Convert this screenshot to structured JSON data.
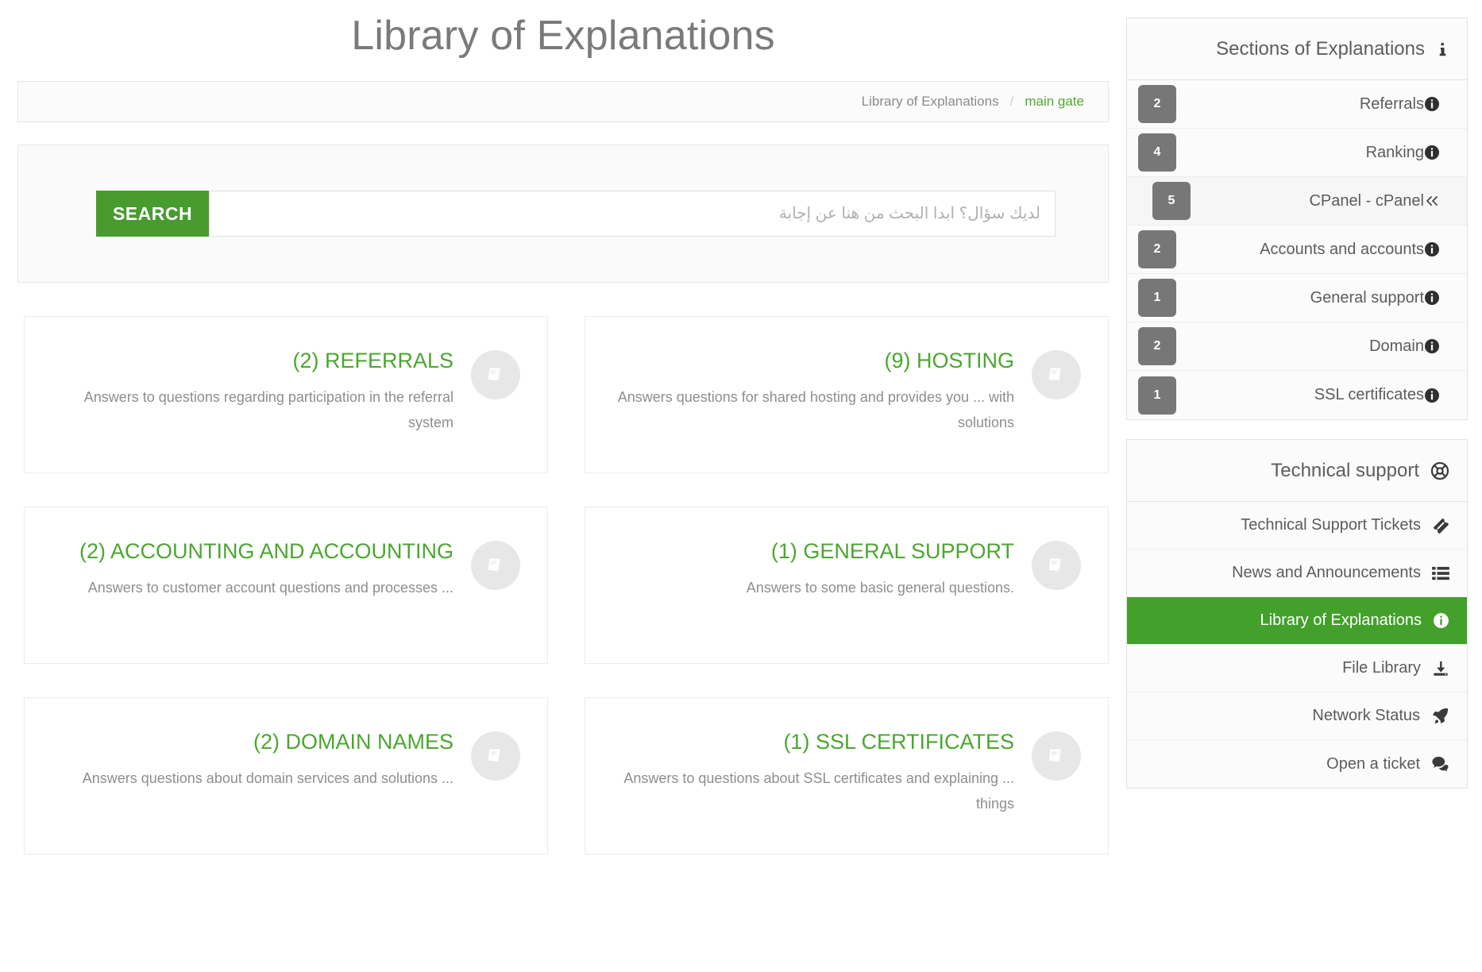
{
  "header": {
    "title": "Library of Explanations"
  },
  "breadcrumb": {
    "parent": "Library of Explanations",
    "separator": "/",
    "current": "main gate"
  },
  "search": {
    "button_label": "SEARCH",
    "placeholder": "لديك سؤال؟ ابدا البحث من هنا عن إجابة",
    "value": ""
  },
  "cards": [
    {
      "title": "(9) HOSTING",
      "description": "Answers questions for shared hosting and provides you ... with solutions",
      "icon": "book-icon"
    },
    {
      "title": "(2) REFERRALS",
      "description": "Answers to questions regarding participation in the referral system",
      "icon": "book-icon"
    },
    {
      "title": "(1) GENERAL SUPPORT",
      "description": ".Answers to some basic general questions",
      "icon": "book-icon"
    },
    {
      "title": "(2) ACCOUNTING AND ACCOUNTING",
      "description": "... Answers to customer account questions and processes",
      "icon": "book-icon"
    },
    {
      "title": "(1) SSL CERTIFICATES",
      "description": "Answers to questions about SSL certificates and explaining ... things",
      "icon": "book-icon"
    },
    {
      "title": "(2) DOMAIN NAMES",
      "description": "... Answers questions about domain services and solutions",
      "icon": "book-icon"
    }
  ],
  "sections_panel": {
    "title": "Sections of Explanations",
    "title_icon": "info-thin-icon",
    "items": [
      {
        "label": "Referrals",
        "count": "2",
        "icon": "info-circle-icon",
        "nested": false
      },
      {
        "label": "Ranking",
        "count": "4",
        "icon": "info-circle-icon",
        "nested": false
      },
      {
        "label": "CPanel - cPanel",
        "count": "5",
        "icon": "double-chevron-left-icon",
        "nested": true
      },
      {
        "label": "Accounts and accounts",
        "count": "2",
        "icon": "info-circle-icon",
        "nested": false
      },
      {
        "label": "General support",
        "count": "1",
        "icon": "info-circle-icon",
        "nested": false
      },
      {
        "label": "Domain",
        "count": "2",
        "icon": "info-circle-icon",
        "nested": false
      },
      {
        "label": "SSL certificates",
        "count": "1",
        "icon": "info-circle-icon",
        "nested": false
      }
    ]
  },
  "support_panel": {
    "title": "Technical support",
    "title_icon": "lifebuoy-icon",
    "items": [
      {
        "label": "Technical Support Tickets",
        "icon": "ticket-icon",
        "active": false
      },
      {
        "label": "News and Announcements",
        "icon": "list-icon",
        "active": false
      },
      {
        "label": "Library of Explanations",
        "icon": "info-circle-icon",
        "active": true
      },
      {
        "label": "File Library",
        "icon": "download-icon",
        "active": false
      },
      {
        "label": "Network Status",
        "icon": "rocket-icon",
        "active": false
      },
      {
        "label": "Open a ticket",
        "icon": "comments-icon",
        "active": false
      }
    ]
  },
  "colors": {
    "accent_green": "#43a02b",
    "title_green": "#4aa72f",
    "button_green": "#489c2f",
    "badge_gray": "#777777",
    "text_gray": "#5c5c5c"
  }
}
